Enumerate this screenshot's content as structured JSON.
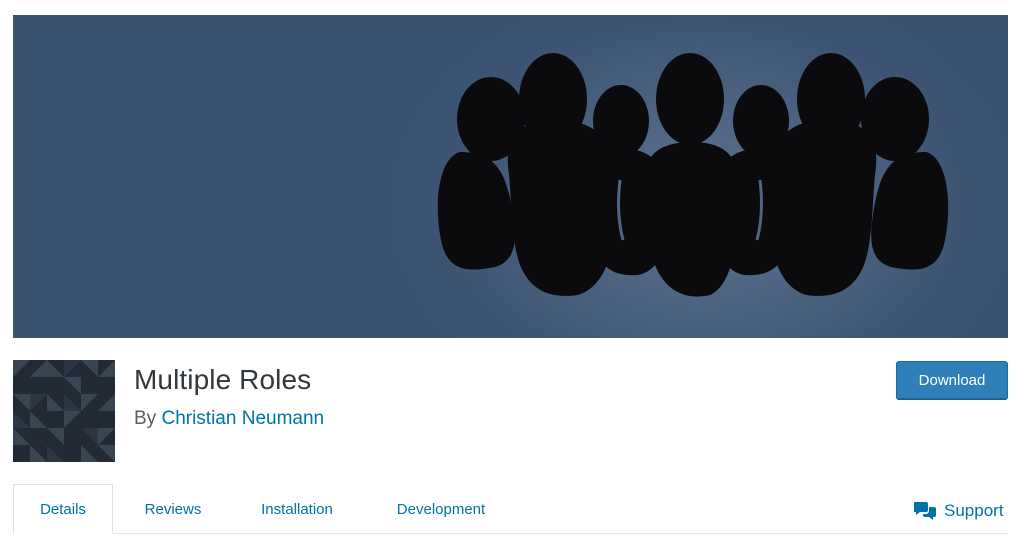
{
  "header": {
    "plugin_name": "Multiple Roles",
    "byline_prefix": "By",
    "author": "Christian Neumann",
    "download_label": "Download"
  },
  "tabs": [
    {
      "label": "Details",
      "active": true
    },
    {
      "label": "Reviews",
      "active": false
    },
    {
      "label": "Installation",
      "active": false
    },
    {
      "label": "Development",
      "active": false
    }
  ],
  "support": {
    "label": "Support",
    "icon": "support-chat-icon"
  },
  "banner": {
    "icon": "people-group-icon",
    "background_color": "#3b5371",
    "figure_color": "#0b0b0d"
  },
  "plugin_icon": {
    "icon": "geometric-pattern-icon",
    "background_color": "#222b35"
  },
  "colors": {
    "link": "#0073aa",
    "button": "#2f80b8"
  }
}
